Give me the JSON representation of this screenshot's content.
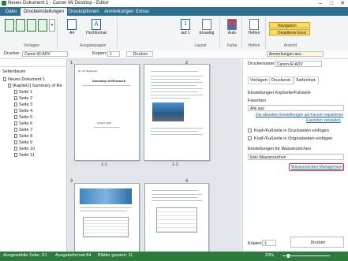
{
  "window": {
    "title": "Neues Dokument 1 - Canon iW Desktop - Editor",
    "minimize": "–",
    "maximize": "□",
    "close": "✕"
  },
  "menu_tabs": [
    "Datei",
    "Druckeinstellungen",
    "Druckoptionen",
    "Anmerkungen",
    "Extras"
  ],
  "ribbon": {
    "buttons": {
      "vorlagen_group": "Vorlagen",
      "duplex": "",
      "a4": "A4",
      "hochformat": "Hochformat",
      "ausgabepapier": "Ausgabepapier",
      "layout_num": "1",
      "auf1": "auf 1",
      "layout": "Layout",
      "einseitig": "Einseitig",
      "auto": "Auto",
      "farbe": "Farbe",
      "heften": "Heften",
      "heften_group": "Heften",
      "navigation": "Navigation",
      "detaillierte_einst": "Detaillierte Einst",
      "ansicht": "Ansicht"
    }
  },
  "toolbar": {
    "drucker_label": "Drucker:",
    "drucker_value": "Canon iR-ADV",
    "kopien_label": "Kopien:",
    "kopien_value": "1",
    "drucken": "Drucken",
    "anmerkungen": "Anmerkungen anz."
  },
  "left_pane": {
    "header": "Seitenbaum",
    "tree": [
      "Neues Dokument 1",
      "[Kapitel1] Summary of Re",
      "Seite 1",
      "Seite 2",
      "Seite 3",
      "Seite 4",
      "Seite 5",
      "Seite 6",
      "Seite 7",
      "Seite 8",
      "Seite 9",
      "Seite 10",
      "Seite 11"
    ]
  },
  "center": {
    "page_numbers": [
      "1",
      "2",
      "3",
      "4"
    ],
    "labels": [
      "1-1",
      "1-2"
    ],
    "page1": {
      "title": "Summary of Research",
      "header": "No. 22 September",
      "date": "10 MAY 2010"
    }
  },
  "right_pane": {
    "drucker_label": "Druckername:",
    "drucker_value": "Canon iR-ADV",
    "tabs": [
      "Vorlagen",
      "Druckerst.",
      "Seitenlnst."
    ],
    "section1": "Einstellungen Kopfzeile/Fußzeile",
    "favoriten_label": "Favoriten",
    "favoriten_value": "Alle aus",
    "link1": "Die aktuellen Einstellungen als Favorit registrieren",
    "link2": "Favoriten verwalten",
    "check1": "Kopf-/Fußzeile in Druckseiten einfügen",
    "check2": "Kopf-/Fußzeile in Originalseiten einfügen",
    "section2": "Einstellungen für Wasserzeichen",
    "wasser_value": "Kein Wasserzeichen",
    "link3": "Wasserzeichen-Management",
    "kopien_label": "Kopien:",
    "kopien_value": "1",
    "drucken": "Drucken"
  },
  "status": {
    "left": "Ausgewählte Seite: /11",
    "format": "Ausgabeformat:A4",
    "blatter": "Blätter gesamt: 11",
    "zoom": "23%"
  },
  "colors": {
    "menubar": "#2f6f8f",
    "status": "#2d7b3c",
    "highlight": "#e02020",
    "link": "#1a5fb4"
  }
}
